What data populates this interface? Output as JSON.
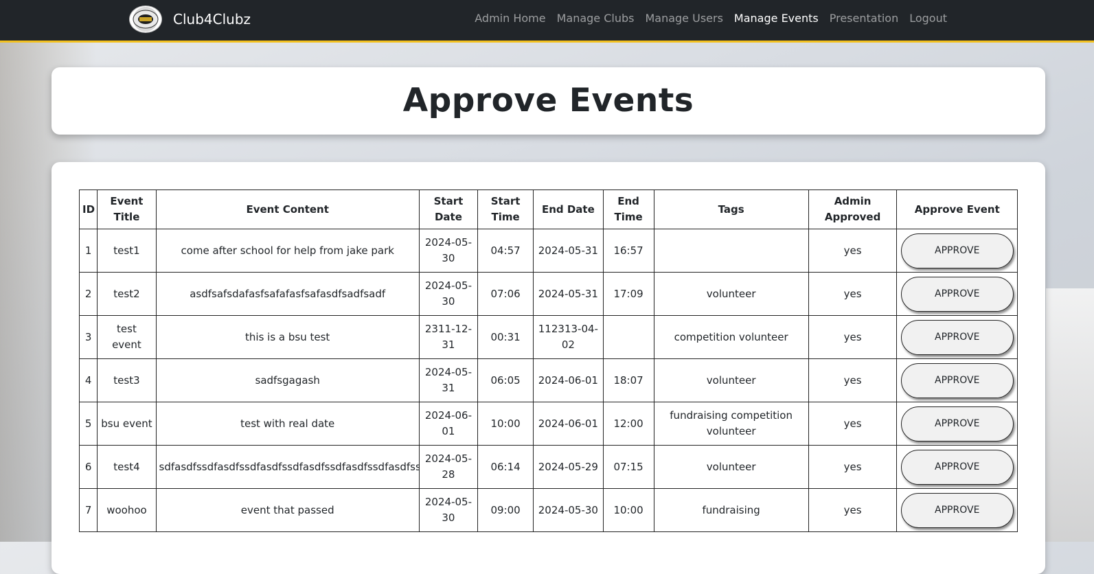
{
  "nav": {
    "brand": "Club4Clubz",
    "links": [
      "Admin Home",
      "Manage Clubs",
      "Manage Users",
      "Manage Events",
      "Presentation",
      "Logout"
    ],
    "active": "Manage Events"
  },
  "page": {
    "title": "Approve Events"
  },
  "table": {
    "headers": [
      "ID",
      "Event Title",
      "Event Content",
      "Start Date",
      "Start Time",
      "End Date",
      "End Time",
      "Tags",
      "Admin Approved",
      "Approve Event"
    ],
    "rows": [
      [
        "1",
        "test1",
        "come after school for help from jake park",
        "2024-05-30",
        "04:57",
        "2024-05-31",
        "16:57",
        "",
        "yes",
        "APPROVE"
      ],
      [
        "2",
        "test2",
        "asdfsafsdafasfsafafasfsafasdfsadfsadf",
        "2024-05-30",
        "07:06",
        "2024-05-31",
        "17:09",
        "volunteer",
        "yes",
        "APPROVE"
      ],
      [
        "3",
        "test event",
        "this is a bsu test",
        "2311-12-31",
        "00:31",
        "112313-04-02",
        "",
        "competition volunteer",
        "yes",
        "APPROVE"
      ],
      [
        "4",
        "test3",
        "sadfsgagash",
        "2024-05-31",
        "06:05",
        "2024-06-01",
        "18:07",
        "volunteer",
        "yes",
        "APPROVE"
      ],
      [
        "5",
        "bsu event",
        "test with real date",
        "2024-06-01",
        "10:00",
        "2024-06-01",
        "12:00",
        "fundraising competition volunteer",
        "yes",
        "APPROVE"
      ],
      [
        "6",
        "test4",
        "sdfasdfssdfasdfssdfasdfssdfasdfssdfasdfssdfasdfssdfas",
        "2024-05-28",
        "06:14",
        "2024-05-29",
        "07:15",
        "volunteer",
        "yes",
        "APPROVE"
      ],
      [
        "7",
        "woohoo",
        "event that passed",
        "2024-05-30",
        "09:00",
        "2024-05-30",
        "10:00",
        "fundraising",
        "yes",
        "APPROVE"
      ]
    ]
  },
  "colors": {
    "navbar": "#212529",
    "accent": "#f2c01e"
  }
}
